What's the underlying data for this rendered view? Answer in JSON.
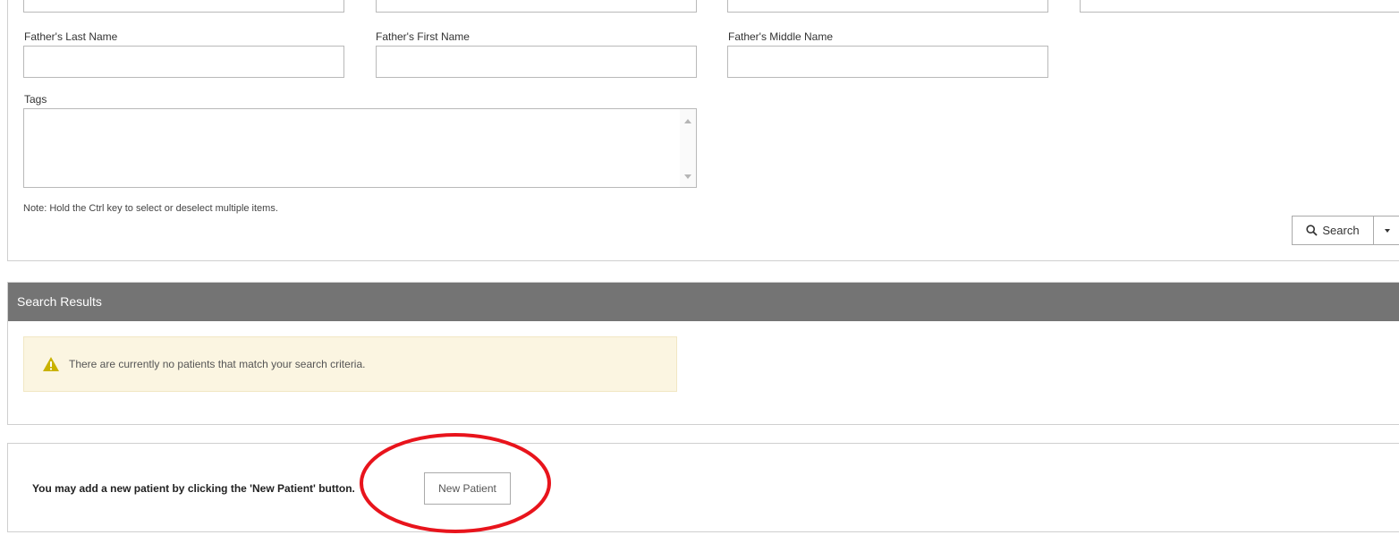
{
  "form": {
    "fathers_last_name_label": "Father's Last Name",
    "fathers_first_name_label": "Father's First Name",
    "fathers_middle_name_label": "Father's Middle Name",
    "fathers_last_name_value": "",
    "fathers_first_name_value": "",
    "fathers_middle_name_value": "",
    "tags_label": "Tags",
    "note": "Note: Hold the Ctrl key to select or deselect multiple items.",
    "search_label": "Search"
  },
  "results": {
    "header": "Search Results",
    "alert_text": "There are currently no patients that match your search criteria.",
    "alert_color": "#fbf5e1",
    "warning_color": "#c9b200"
  },
  "add_patient": {
    "text": "You may add a new patient by clicking the 'New Patient' button.",
    "button_label": "New Patient"
  },
  "annotation": {
    "circle_color": "#e8141c"
  },
  "icons": {
    "search": "search-icon",
    "dropdown": "chevron-down-icon",
    "warning": "warning-icon"
  }
}
